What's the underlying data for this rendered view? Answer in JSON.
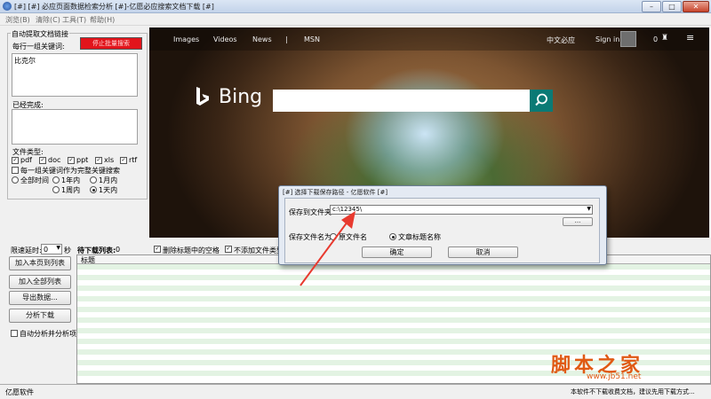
{
  "window": {
    "title": "[#] [#] 必应页面数据检索分析 [#]-亿愿必应搜索文档下载 [#]",
    "min": "–",
    "max": "□",
    "close": "✕"
  },
  "menu": [
    "浏览(B)",
    "清除(C)",
    "工具(T)",
    "帮助(H)"
  ],
  "left": {
    "group_title": "自动提取文档链接",
    "keywords_label": "每行一组关键词:",
    "stop_button": "停止批量搜索",
    "keywords_value": "比克尔",
    "done_label": "已经完成:",
    "filetype_label": "文件类型:",
    "filetypes": [
      {
        "label": "pdf",
        "checked": true
      },
      {
        "label": "doc",
        "checked": true
      },
      {
        "label": "ppt",
        "checked": true
      },
      {
        "label": "xls",
        "checked": true
      },
      {
        "label": "rtf",
        "checked": true
      }
    ],
    "complete_search_label": "每一组关键词作为完整关键搜索",
    "time_options": [
      {
        "label": "全部时间",
        "selected": false
      },
      {
        "label": "1年内",
        "selected": false
      },
      {
        "label": "1月内",
        "selected": false
      },
      {
        "label": "1周内",
        "selected": false
      },
      {
        "label": "1天内",
        "selected": true
      }
    ]
  },
  "bing": {
    "nav": [
      "Images",
      "Videos",
      "News",
      "|",
      "MSN"
    ],
    "right": [
      "中文必应",
      "Sign in",
      "0"
    ],
    "logo_text": "Bing",
    "search_placeholder": ""
  },
  "toolbar2": {
    "delay_label": "限速延时:",
    "delay_value": "0",
    "delay_unit": "秒",
    "pending_label": "待下载列表:",
    "pending_count": "0",
    "remove_space_label": "删除标题中的空格",
    "no_filetype_label": "不添加文件类型"
  },
  "buttons": {
    "add_page": "加入本页到列表",
    "add_all": "加入全部列表",
    "export": "导出数据...",
    "analyze": "分析下载",
    "auto_analyze": "自动分析并分析项"
  },
  "grid": {
    "header": "标题"
  },
  "dialog": {
    "title": "[#] 选择下载保存路径 - 亿愿软件 [#]",
    "folder_label": "保存到文件夹:",
    "folder_value": "c:\\12345\\",
    "browse_button": "...",
    "filename_label": "保存文件名为:",
    "opt_original": "原文件名",
    "opt_title": "文章标题名称",
    "ok_button": "确定",
    "cancel_button": "取消"
  },
  "status": {
    "left": "亿愿软件",
    "right": "本软件不下载收费文档，建议先用下载方式..."
  },
  "watermark": {
    "cn": "脚本之家",
    "url": "www.jb51.net"
  }
}
